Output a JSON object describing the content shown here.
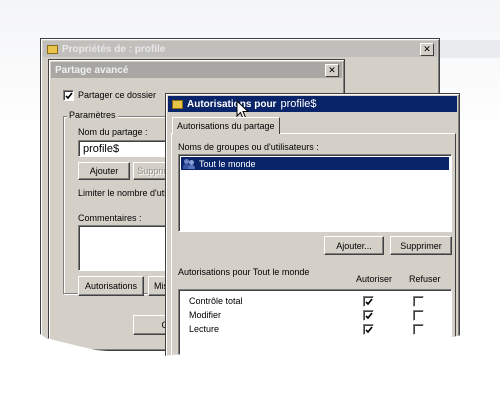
{
  "window_props": {
    "title": "Propriétés de : profile"
  },
  "window_advanced": {
    "title": "Partage avancé",
    "share_checkbox_label": "Partager ce dossier",
    "params_group": "Paramètres",
    "share_name_label": "Nom du partage :",
    "share_name_value": "profile$",
    "add_button": "Ajouter",
    "remove_button": "Supprimer",
    "limit_label": "Limiter le nombre d'utilisateurs",
    "comments_label": "Commentaires :",
    "permissions_button": "Autorisations",
    "cache_button": "Mise en cache",
    "ok_button": "OK"
  },
  "window_perms": {
    "title_prefix": "Autorisations pour",
    "title_share": "profile$",
    "tab_label": "Autorisations du partage",
    "groups_label": "Noms de groupes ou d'utilisateurs :",
    "groups": [
      {
        "name": "Tout le monde",
        "selected": true
      }
    ],
    "add_button": "Ajouter...",
    "remove_button": "Supprimer",
    "perms_for_label": "Autorisations pour Tout le monde",
    "allow_header": "Autoriser",
    "deny_header": "Refuser",
    "permissions": [
      {
        "name": "Contrôle total",
        "allow": true,
        "deny": false
      },
      {
        "name": "Modifier",
        "allow": true,
        "deny": false
      },
      {
        "name": "Lecture",
        "allow": true,
        "deny": false
      }
    ]
  },
  "colors": {
    "title_active": "#0a246a",
    "face": "#d4d0c8"
  },
  "icons": [
    "folder-icon",
    "users-group-icon",
    "close-icon",
    "mouse-cursor-icon",
    "checkmark-icon"
  ]
}
